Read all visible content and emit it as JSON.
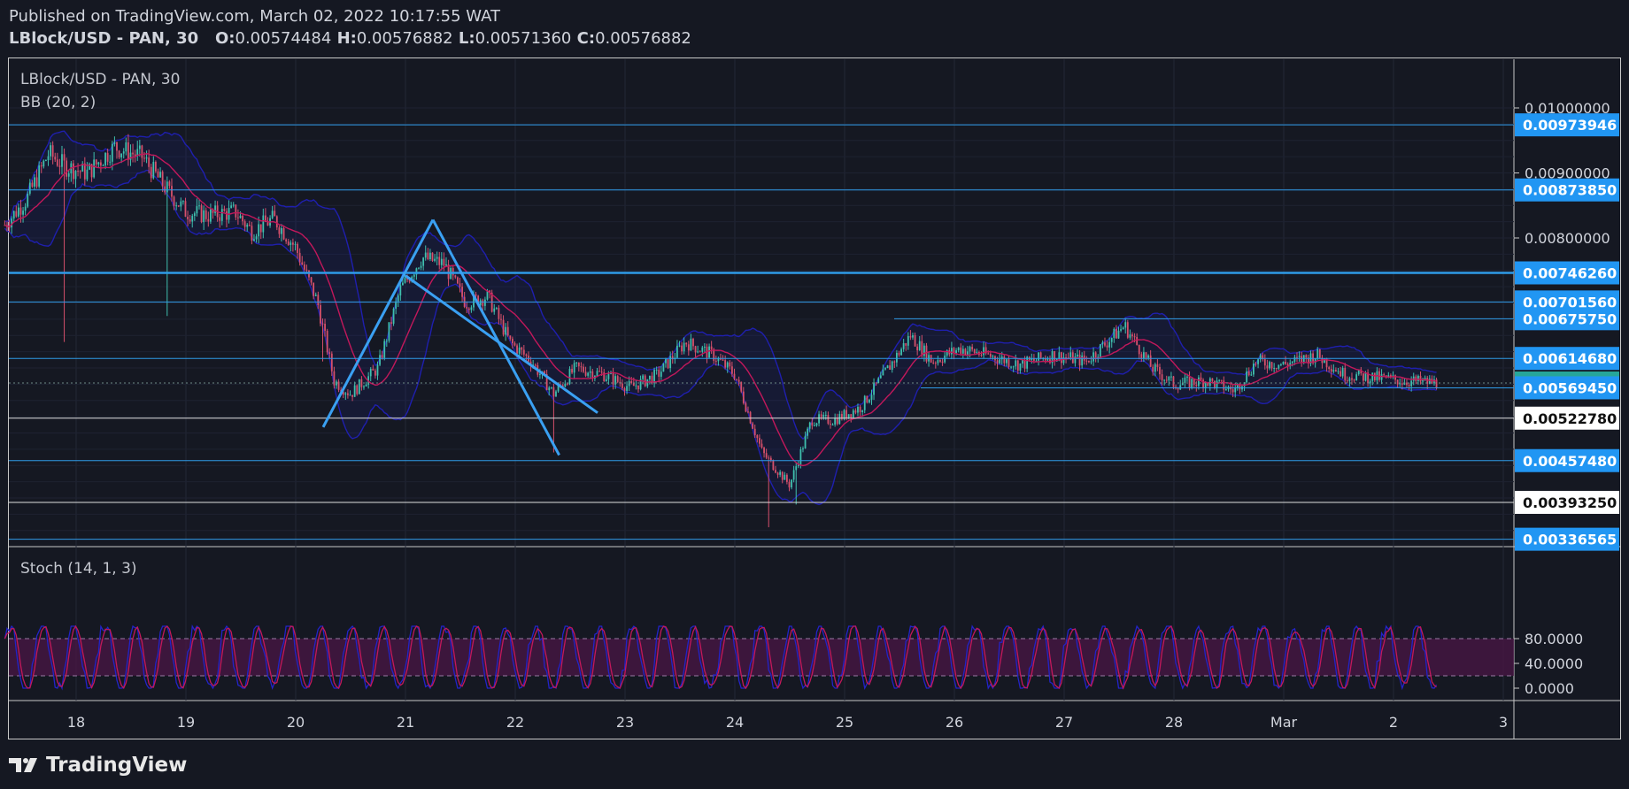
{
  "header": {
    "published": "Published on TradingView.com, March 02, 2022 10:17:55 WAT",
    "symbol": "LBlock/USD - PAN, 30",
    "o_label": "O:",
    "o_value": "0.00574484",
    "h_label": "H:",
    "h_value": "0.00576882",
    "l_label": "L:",
    "l_value": "0.00571360",
    "c_label": "C:",
    "c_value": "0.00576882"
  },
  "pane": {
    "symbol_label": "LBlock/USD - PAN, 30",
    "bb_label": "BB (20, 2)",
    "stoch_label": "Stoch (14, 1, 3)"
  },
  "footer": {
    "brand": "TradingView"
  },
  "colors": {
    "background": "#151822",
    "hline_blue": "#2f9be8",
    "tag_blue": "#2196f3",
    "tag_green": "#26a69a",
    "bb_band": "#1f1fae",
    "bb_basis": "#c2185b",
    "stoch_k": "#2323c8",
    "stoch_d": "#c2185b",
    "stoch_fill": "#4a1545",
    "pattern": "#3aa0f2"
  },
  "chart_data": [
    {
      "type": "line",
      "subtype": "candlestick",
      "title": "LBlock/USD - PAN, 30",
      "indicator": "BB (20, 2)",
      "x_ticks": [
        "18",
        "19",
        "20",
        "21",
        "22",
        "23",
        "24",
        "25",
        "26",
        "27",
        "28",
        "Mar",
        "2",
        "3"
      ],
      "y_ticks": [
        "0.01000000",
        "0.00900000",
        "0.00800000"
      ],
      "ylim": [
        0.0029,
        0.0107
      ],
      "close_series": [
        [
          17.35,
          0.0082
        ],
        [
          17.55,
          0.0086
        ],
        [
          17.75,
          0.0093
        ],
        [
          17.9,
          0.0091
        ],
        [
          18.1,
          0.009
        ],
        [
          18.35,
          0.0094
        ],
        [
          18.6,
          0.00925
        ],
        [
          18.8,
          0.0088
        ],
        [
          19.0,
          0.0084
        ],
        [
          19.2,
          0.00835
        ],
        [
          19.45,
          0.0084
        ],
        [
          19.6,
          0.0081
        ],
        [
          19.8,
          0.0083
        ],
        [
          20.0,
          0.00785
        ],
        [
          20.2,
          0.007
        ],
        [
          20.35,
          0.0058
        ],
        [
          20.5,
          0.0056
        ],
        [
          20.75,
          0.006
        ],
        [
          20.95,
          0.0072
        ],
        [
          21.15,
          0.0077
        ],
        [
          21.35,
          0.0076
        ],
        [
          21.55,
          0.007
        ],
        [
          21.75,
          0.0071
        ],
        [
          21.95,
          0.0064
        ],
        [
          22.15,
          0.0061
        ],
        [
          22.35,
          0.0056
        ],
        [
          22.55,
          0.006
        ],
        [
          22.8,
          0.0059
        ],
        [
          23.05,
          0.0057
        ],
        [
          23.3,
          0.0059
        ],
        [
          23.55,
          0.0064
        ],
        [
          23.8,
          0.0062
        ],
        [
          24.0,
          0.0059
        ],
        [
          24.25,
          0.0047
        ],
        [
          24.5,
          0.0042
        ],
        [
          24.7,
          0.0052
        ],
        [
          24.9,
          0.0052
        ],
        [
          25.15,
          0.0054
        ],
        [
          25.4,
          0.006
        ],
        [
          25.6,
          0.0065
        ],
        [
          25.8,
          0.0061
        ],
        [
          26.05,
          0.0063
        ],
        [
          26.3,
          0.0062
        ],
        [
          26.6,
          0.00605
        ],
        [
          26.9,
          0.0062
        ],
        [
          27.2,
          0.0061
        ],
        [
          27.55,
          0.00665
        ],
        [
          27.8,
          0.006
        ],
        [
          28.0,
          0.00575
        ],
        [
          28.3,
          0.0058
        ],
        [
          28.55,
          0.00565
        ],
        [
          28.75,
          0.0061
        ],
        [
          29.0,
          0.00605
        ],
        [
          29.3,
          0.0062
        ],
        [
          29.55,
          0.0059
        ],
        [
          29.85,
          0.00585
        ],
        [
          30.1,
          0.0058
        ],
        [
          30.4,
          0.00577
        ]
      ],
      "horizontal_levels": [
        {
          "value": 0.00973946,
          "label": "0.00973946",
          "tag": "blue"
        },
        {
          "value": 0.0087385,
          "label": "0.00873850",
          "tag": "blue"
        },
        {
          "value": 0.0074626,
          "label": "0.00746260",
          "tag": "blue"
        },
        {
          "value": 0.0070156,
          "label": "0.00701560",
          "tag": "blue"
        },
        {
          "value": 0.0067575,
          "label": "0.00675750",
          "tag": "blue"
        },
        {
          "value": 0.0061468,
          "label": "0.00614680",
          "tag": "blue"
        },
        {
          "value": 0.00576882,
          "label": "0.00576882",
          "tag": "green"
        },
        {
          "value": 0.0056945,
          "label": "0.00569450",
          "tag": "blue"
        },
        {
          "value": 0.0052278,
          "label": "0.00522780",
          "tag": "white"
        },
        {
          "value": 0.0045748,
          "label": "0.00457480",
          "tag": "blue"
        },
        {
          "value": 0.0039325,
          "label": "0.00393250",
          "tag": "white"
        },
        {
          "value": 0.00336565,
          "label": "0.00336565",
          "tag": "blue"
        }
      ],
      "pattern_lines": [
        {
          "x": [
            20.25,
            21.25
          ],
          "y": [
            0.00509,
            0.00828
          ]
        },
        {
          "x": [
            21.25,
            22.4
          ],
          "y": [
            0.00828,
            0.00466
          ]
        },
        {
          "x": [
            21.0,
            22.75
          ],
          "y": [
            0.00742,
            0.00531
          ]
        }
      ],
      "grid": true
    },
    {
      "type": "line",
      "indicator": "Stoch (14, 1, 3)",
      "y_ticks": [
        "80.0000",
        "40.0000",
        "0.0000"
      ],
      "ylim": [
        -10,
        110
      ],
      "bands": [
        20,
        80
      ]
    }
  ]
}
